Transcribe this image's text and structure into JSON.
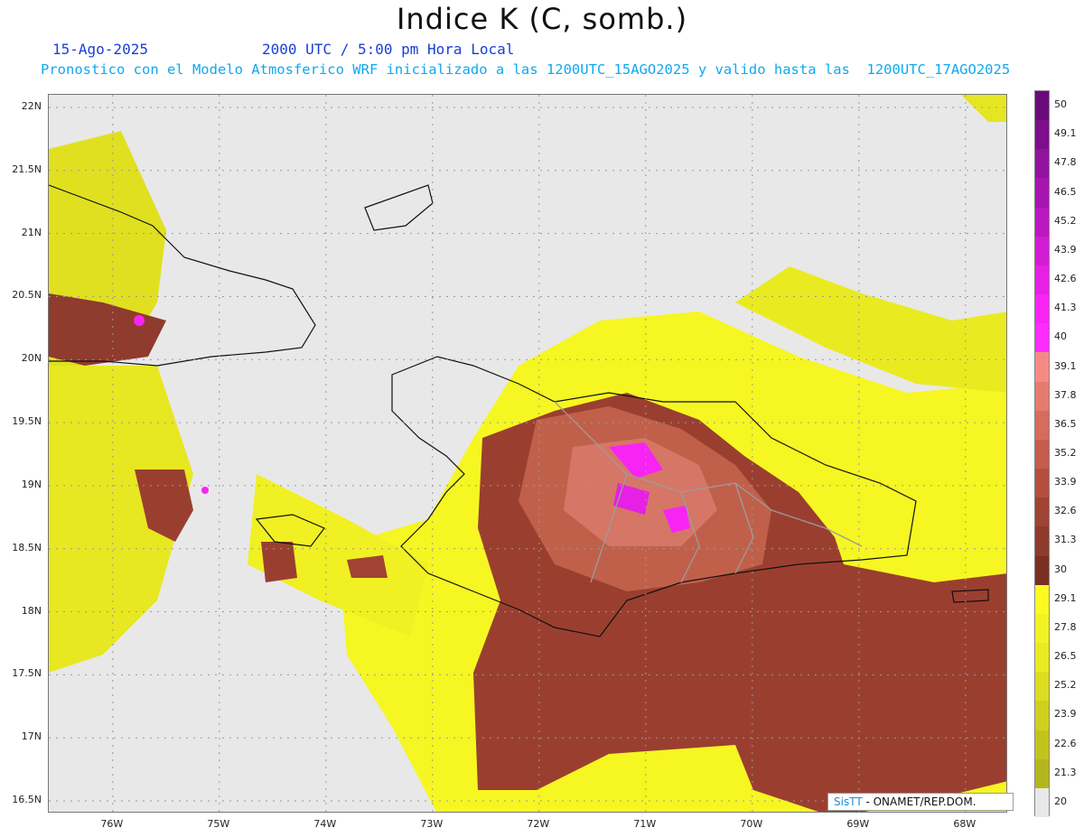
{
  "header": {
    "title": "Indice K (C, somb.)",
    "date": "15-Ago-2025",
    "time": "2000 UTC / 5:00 pm Hora Local",
    "forecast": "Pronostico con el Modelo Atmosferico WRF inicializado a las 1200UTC_15AGO2025 y valido hasta las  1200UTC_17AGO2025"
  },
  "map": {
    "lat_labels": [
      "22N",
      "21.5N",
      "21N",
      "20.5N",
      "20N",
      "19.5N",
      "19N",
      "18.5N",
      "18N",
      "17.5N",
      "17N",
      "16.5N"
    ],
    "lon_labels": [
      "76W",
      "75W",
      "74W",
      "73W",
      "72W",
      "71W",
      "70W",
      "69W",
      "68W"
    ],
    "extent": {
      "lon_min": -76.6,
      "lon_max": -67.6,
      "lat_min": 16.4,
      "lat_max": 22.1
    }
  },
  "legend": {
    "levels": [
      "50",
      "49.1",
      "47.8",
      "46.5",
      "45.2",
      "43.9",
      "42.6",
      "41.3",
      "40",
      "39.1",
      "37.8",
      "36.5",
      "35.2",
      "33.9",
      "32.6",
      "31.3",
      "30",
      "29.1",
      "27.8",
      "26.5",
      "25.2",
      "23.9",
      "22.6",
      "21.3",
      "20"
    ],
    "colors": [
      "#6a0a7a",
      "#7d0e8c",
      "#92129e",
      "#a814b0",
      "#bc18c2",
      "#d21cd4",
      "#e620e4",
      "#f824f6",
      "#ff2cff",
      "#f58a84",
      "#e67a70",
      "#d66b5e",
      "#c55d4e",
      "#b44f40",
      "#a04334",
      "#8e3a2c",
      "#7a2f22",
      "#fbfb22",
      "#f3f323",
      "#e9ea22",
      "#dcdd20",
      "#cfd01e",
      "#c2c31d",
      "#b4b61b",
      "#e8e8e8"
    ]
  },
  "credit": {
    "brand": "SisTT",
    "text": " - ONAMET/REP.DOM."
  }
}
